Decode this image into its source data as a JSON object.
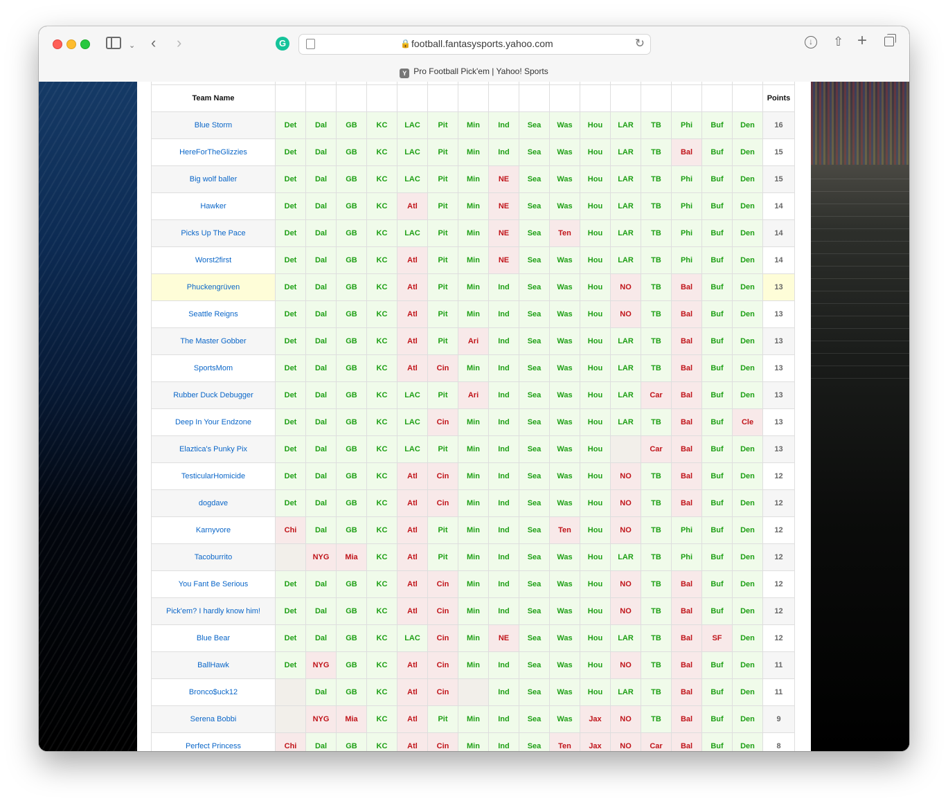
{
  "browser": {
    "url": "football.fantasysports.yahoo.com",
    "tab_title": "Pro Football Pick'em | Yahoo! Sports",
    "favicon_letter": "Y"
  },
  "table": {
    "name_header": "Team Name",
    "points_header": "Points",
    "rows": [
      {
        "team": "Blue Storm",
        "picks": [
          "Det",
          "Dal",
          "GB",
          "KC",
          "LAC",
          "Pit",
          "Min",
          "Ind",
          "Sea",
          "Was",
          "Hou",
          "LAR",
          "TB",
          "Phi",
          "Buf",
          "Den"
        ],
        "results": [
          "W",
          "W",
          "W",
          "W",
          "W",
          "W",
          "W",
          "W",
          "W",
          "W",
          "W",
          "W",
          "W",
          "W",
          "W",
          "W"
        ],
        "points": "16",
        "me": false
      },
      {
        "team": "HereForTheGlizzies",
        "picks": [
          "Det",
          "Dal",
          "GB",
          "KC",
          "LAC",
          "Pit",
          "Min",
          "Ind",
          "Sea",
          "Was",
          "Hou",
          "LAR",
          "TB",
          "Bal",
          "Buf",
          "Den"
        ],
        "results": [
          "W",
          "W",
          "W",
          "W",
          "W",
          "W",
          "W",
          "W",
          "W",
          "W",
          "W",
          "W",
          "W",
          "L",
          "W",
          "W"
        ],
        "points": "15",
        "me": false
      },
      {
        "team": "Big wolf baller",
        "picks": [
          "Det",
          "Dal",
          "GB",
          "KC",
          "LAC",
          "Pit",
          "Min",
          "NE",
          "Sea",
          "Was",
          "Hou",
          "LAR",
          "TB",
          "Phi",
          "Buf",
          "Den"
        ],
        "results": [
          "W",
          "W",
          "W",
          "W",
          "W",
          "W",
          "W",
          "L",
          "W",
          "W",
          "W",
          "W",
          "W",
          "W",
          "W",
          "W"
        ],
        "points": "15",
        "me": false
      },
      {
        "team": "Hawker",
        "picks": [
          "Det",
          "Dal",
          "GB",
          "KC",
          "Atl",
          "Pit",
          "Min",
          "NE",
          "Sea",
          "Was",
          "Hou",
          "LAR",
          "TB",
          "Phi",
          "Buf",
          "Den"
        ],
        "results": [
          "W",
          "W",
          "W",
          "W",
          "L",
          "W",
          "W",
          "L",
          "W",
          "W",
          "W",
          "W",
          "W",
          "W",
          "W",
          "W"
        ],
        "points": "14",
        "me": false
      },
      {
        "team": "Picks Up The Pace",
        "picks": [
          "Det",
          "Dal",
          "GB",
          "KC",
          "LAC",
          "Pit",
          "Min",
          "NE",
          "Sea",
          "Ten",
          "Hou",
          "LAR",
          "TB",
          "Phi",
          "Buf",
          "Den"
        ],
        "results": [
          "W",
          "W",
          "W",
          "W",
          "W",
          "W",
          "W",
          "L",
          "W",
          "L",
          "W",
          "W",
          "W",
          "W",
          "W",
          "W"
        ],
        "points": "14",
        "me": false
      },
      {
        "team": "Worst2first",
        "picks": [
          "Det",
          "Dal",
          "GB",
          "KC",
          "Atl",
          "Pit",
          "Min",
          "NE",
          "Sea",
          "Was",
          "Hou",
          "LAR",
          "TB",
          "Phi",
          "Buf",
          "Den"
        ],
        "results": [
          "W",
          "W",
          "W",
          "W",
          "L",
          "W",
          "W",
          "L",
          "W",
          "W",
          "W",
          "W",
          "W",
          "W",
          "W",
          "W"
        ],
        "points": "14",
        "me": false
      },
      {
        "team": "Phuckengrüven",
        "picks": [
          "Det",
          "Dal",
          "GB",
          "KC",
          "Atl",
          "Pit",
          "Min",
          "Ind",
          "Sea",
          "Was",
          "Hou",
          "NO",
          "TB",
          "Bal",
          "Buf",
          "Den"
        ],
        "results": [
          "W",
          "W",
          "W",
          "W",
          "L",
          "W",
          "W",
          "W",
          "W",
          "W",
          "W",
          "L",
          "W",
          "L",
          "W",
          "W"
        ],
        "points": "13",
        "me": true
      },
      {
        "team": "Seattle Reigns",
        "picks": [
          "Det",
          "Dal",
          "GB",
          "KC",
          "Atl",
          "Pit",
          "Min",
          "Ind",
          "Sea",
          "Was",
          "Hou",
          "NO",
          "TB",
          "Bal",
          "Buf",
          "Den"
        ],
        "results": [
          "W",
          "W",
          "W",
          "W",
          "L",
          "W",
          "W",
          "W",
          "W",
          "W",
          "W",
          "L",
          "W",
          "L",
          "W",
          "W"
        ],
        "points": "13",
        "me": false
      },
      {
        "team": "The Master Gobber",
        "picks": [
          "Det",
          "Dal",
          "GB",
          "KC",
          "Atl",
          "Pit",
          "Ari",
          "Ind",
          "Sea",
          "Was",
          "Hou",
          "LAR",
          "TB",
          "Bal",
          "Buf",
          "Den"
        ],
        "results": [
          "W",
          "W",
          "W",
          "W",
          "L",
          "W",
          "L",
          "W",
          "W",
          "W",
          "W",
          "W",
          "W",
          "L",
          "W",
          "W"
        ],
        "points": "13",
        "me": false
      },
      {
        "team": "SportsMom",
        "picks": [
          "Det",
          "Dal",
          "GB",
          "KC",
          "Atl",
          "Cin",
          "Min",
          "Ind",
          "Sea",
          "Was",
          "Hou",
          "LAR",
          "TB",
          "Bal",
          "Buf",
          "Den"
        ],
        "results": [
          "W",
          "W",
          "W",
          "W",
          "L",
          "L",
          "W",
          "W",
          "W",
          "W",
          "W",
          "W",
          "W",
          "L",
          "W",
          "W"
        ],
        "points": "13",
        "me": false
      },
      {
        "team": "Rubber Duck Debugger",
        "picks": [
          "Det",
          "Dal",
          "GB",
          "KC",
          "LAC",
          "Pit",
          "Ari",
          "Ind",
          "Sea",
          "Was",
          "Hou",
          "LAR",
          "Car",
          "Bal",
          "Buf",
          "Den"
        ],
        "results": [
          "W",
          "W",
          "W",
          "W",
          "W",
          "W",
          "L",
          "W",
          "W",
          "W",
          "W",
          "W",
          "L",
          "L",
          "W",
          "W"
        ],
        "points": "13",
        "me": false
      },
      {
        "team": "Deep In Your Endzone",
        "picks": [
          "Det",
          "Dal",
          "GB",
          "KC",
          "LAC",
          "Cin",
          "Min",
          "Ind",
          "Sea",
          "Was",
          "Hou",
          "LAR",
          "TB",
          "Bal",
          "Buf",
          "Cle"
        ],
        "results": [
          "W",
          "W",
          "W",
          "W",
          "W",
          "L",
          "W",
          "W",
          "W",
          "W",
          "W",
          "W",
          "W",
          "L",
          "W",
          "L"
        ],
        "points": "13",
        "me": false
      },
      {
        "team": "Elaztica's Punky Pix",
        "picks": [
          "Det",
          "Dal",
          "GB",
          "KC",
          "LAC",
          "Pit",
          "Min",
          "Ind",
          "Sea",
          "Was",
          "Hou",
          "",
          "Car",
          "Bal",
          "Buf",
          "Den"
        ],
        "results": [
          "W",
          "W",
          "W",
          "W",
          "W",
          "W",
          "W",
          "W",
          "W",
          "W",
          "W",
          "N",
          "L",
          "L",
          "W",
          "W"
        ],
        "points": "13",
        "me": false
      },
      {
        "team": "TesticularHomicide",
        "picks": [
          "Det",
          "Dal",
          "GB",
          "KC",
          "Atl",
          "Cin",
          "Min",
          "Ind",
          "Sea",
          "Was",
          "Hou",
          "NO",
          "TB",
          "Bal",
          "Buf",
          "Den"
        ],
        "results": [
          "W",
          "W",
          "W",
          "W",
          "L",
          "L",
          "W",
          "W",
          "W",
          "W",
          "W",
          "L",
          "W",
          "L",
          "W",
          "W"
        ],
        "points": "12",
        "me": false
      },
      {
        "team": "dogdave",
        "picks": [
          "Det",
          "Dal",
          "GB",
          "KC",
          "Atl",
          "Cin",
          "Min",
          "Ind",
          "Sea",
          "Was",
          "Hou",
          "NO",
          "TB",
          "Bal",
          "Buf",
          "Den"
        ],
        "results": [
          "W",
          "W",
          "W",
          "W",
          "L",
          "L",
          "W",
          "W",
          "W",
          "W",
          "W",
          "L",
          "W",
          "L",
          "W",
          "W"
        ],
        "points": "12",
        "me": false
      },
      {
        "team": "Karnyvore",
        "picks": [
          "Chi",
          "Dal",
          "GB",
          "KC",
          "Atl",
          "Pit",
          "Min",
          "Ind",
          "Sea",
          "Ten",
          "Hou",
          "NO",
          "TB",
          "Phi",
          "Buf",
          "Den"
        ],
        "results": [
          "L",
          "W",
          "W",
          "W",
          "L",
          "W",
          "W",
          "W",
          "W",
          "L",
          "W",
          "L",
          "W",
          "W",
          "W",
          "W"
        ],
        "points": "12",
        "me": false
      },
      {
        "team": "Tacoburrito",
        "picks": [
          "",
          "NYG",
          "Mia",
          "KC",
          "Atl",
          "Pit",
          "Min",
          "Ind",
          "Sea",
          "Was",
          "Hou",
          "LAR",
          "TB",
          "Phi",
          "Buf",
          "Den"
        ],
        "results": [
          "N",
          "L",
          "L",
          "W",
          "L",
          "W",
          "W",
          "W",
          "W",
          "W",
          "W",
          "W",
          "W",
          "W",
          "W",
          "W"
        ],
        "points": "12",
        "me": false
      },
      {
        "team": "You Fant Be Serious",
        "picks": [
          "Det",
          "Dal",
          "GB",
          "KC",
          "Atl",
          "Cin",
          "Min",
          "Ind",
          "Sea",
          "Was",
          "Hou",
          "NO",
          "TB",
          "Bal",
          "Buf",
          "Den"
        ],
        "results": [
          "W",
          "W",
          "W",
          "W",
          "L",
          "L",
          "W",
          "W",
          "W",
          "W",
          "W",
          "L",
          "W",
          "L",
          "W",
          "W"
        ],
        "points": "12",
        "me": false
      },
      {
        "team": "Pick'em? I hardly know him!",
        "picks": [
          "Det",
          "Dal",
          "GB",
          "KC",
          "Atl",
          "Cin",
          "Min",
          "Ind",
          "Sea",
          "Was",
          "Hou",
          "NO",
          "TB",
          "Bal",
          "Buf",
          "Den"
        ],
        "results": [
          "W",
          "W",
          "W",
          "W",
          "L",
          "L",
          "W",
          "W",
          "W",
          "W",
          "W",
          "L",
          "W",
          "L",
          "W",
          "W"
        ],
        "points": "12",
        "me": false
      },
      {
        "team": "Blue Bear",
        "picks": [
          "Det",
          "Dal",
          "GB",
          "KC",
          "LAC",
          "Cin",
          "Min",
          "NE",
          "Sea",
          "Was",
          "Hou",
          "LAR",
          "TB",
          "Bal",
          "SF",
          "Den"
        ],
        "results": [
          "W",
          "W",
          "W",
          "W",
          "W",
          "L",
          "W",
          "L",
          "W",
          "W",
          "W",
          "W",
          "W",
          "L",
          "L",
          "W"
        ],
        "points": "12",
        "me": false
      },
      {
        "team": "BallHawk",
        "picks": [
          "Det",
          "NYG",
          "GB",
          "KC",
          "Atl",
          "Cin",
          "Min",
          "Ind",
          "Sea",
          "Was",
          "Hou",
          "NO",
          "TB",
          "Bal",
          "Buf",
          "Den"
        ],
        "results": [
          "W",
          "L",
          "W",
          "W",
          "L",
          "L",
          "W",
          "W",
          "W",
          "W",
          "W",
          "L",
          "W",
          "L",
          "W",
          "W"
        ],
        "points": "11",
        "me": false
      },
      {
        "team": "Bronco$uck12",
        "picks": [
          "",
          "Dal",
          "GB",
          "KC",
          "Atl",
          "Cin",
          "",
          "Ind",
          "Sea",
          "Was",
          "Hou",
          "LAR",
          "TB",
          "Bal",
          "Buf",
          "Den"
        ],
        "results": [
          "N",
          "W",
          "W",
          "W",
          "L",
          "L",
          "N",
          "W",
          "W",
          "W",
          "W",
          "W",
          "W",
          "L",
          "W",
          "W"
        ],
        "points": "11",
        "me": false
      },
      {
        "team": "Serena Bobbi",
        "picks": [
          "",
          "NYG",
          "Mia",
          "KC",
          "Atl",
          "Pit",
          "Min",
          "Ind",
          "Sea",
          "Was",
          "Jax",
          "NO",
          "TB",
          "Bal",
          "Buf",
          "Den"
        ],
        "results": [
          "N",
          "L",
          "L",
          "W",
          "L",
          "W",
          "W",
          "W",
          "W",
          "W",
          "L",
          "L",
          "W",
          "L",
          "W",
          "W"
        ],
        "points": "9",
        "me": false
      },
      {
        "team": "Perfect Princess",
        "picks": [
          "Chi",
          "Dal",
          "GB",
          "KC",
          "Atl",
          "Cin",
          "Min",
          "Ind",
          "Sea",
          "Ten",
          "Jax",
          "NO",
          "Car",
          "Bal",
          "Buf",
          "Den"
        ],
        "results": [
          "L",
          "W",
          "W",
          "W",
          "L",
          "L",
          "W",
          "W",
          "W",
          "L",
          "L",
          "L",
          "L",
          "L",
          "W",
          "W"
        ],
        "points": "8",
        "me": false
      }
    ]
  }
}
